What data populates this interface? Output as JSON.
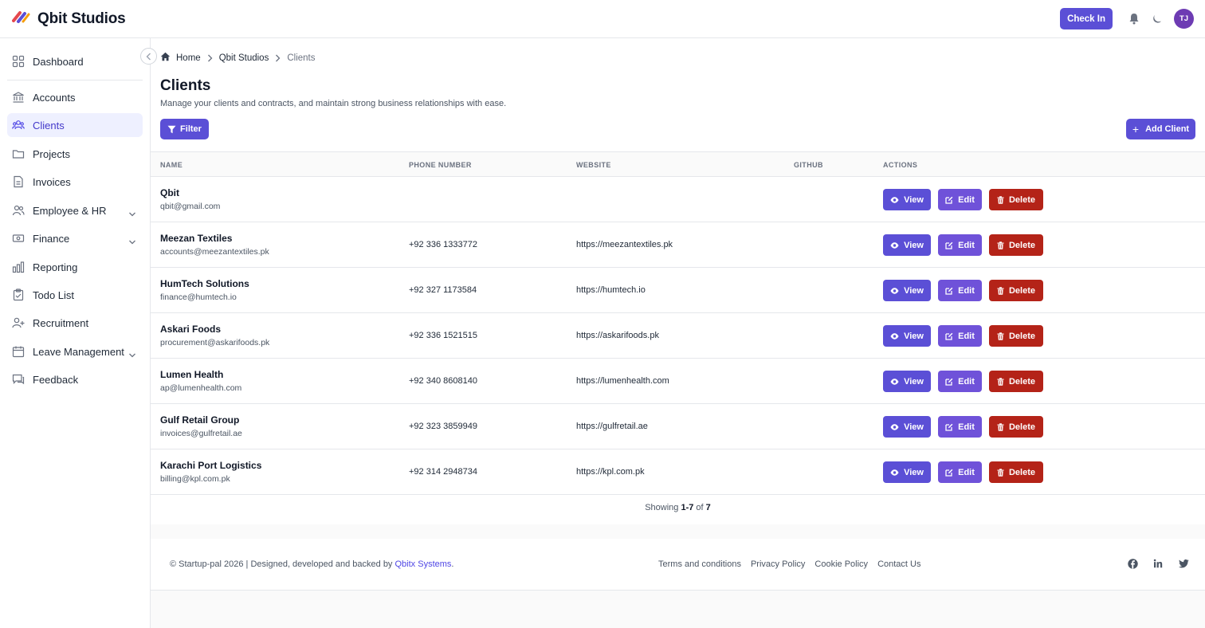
{
  "app": {
    "name": "Qbit Studios"
  },
  "topbar": {
    "checkin_label": "Check In",
    "avatar_initials": "TJ"
  },
  "sidebar": {
    "items": [
      {
        "label": "Dashboard",
        "icon": "dashboard-icon"
      },
      {
        "label": "Accounts",
        "icon": "bank-icon"
      },
      {
        "label": "Clients",
        "icon": "users-icon",
        "active": true
      },
      {
        "label": "Projects",
        "icon": "folder-icon"
      },
      {
        "label": "Invoices",
        "icon": "document-icon"
      },
      {
        "label": "Employee & HR",
        "icon": "people-icon",
        "expandable": true
      },
      {
        "label": "Finance",
        "icon": "money-icon",
        "expandable": true
      },
      {
        "label": "Reporting",
        "icon": "bar-chart-icon"
      },
      {
        "label": "Todo List",
        "icon": "clipboard-icon"
      },
      {
        "label": "Recruitment",
        "icon": "user-plus-icon"
      },
      {
        "label": "Leave Management",
        "icon": "calendar-icon",
        "expandable": true
      },
      {
        "label": "Feedback",
        "icon": "chat-icon"
      }
    ]
  },
  "breadcrumb": {
    "home": "Home",
    "parent": "Qbit Studios",
    "current": "Clients"
  },
  "page": {
    "title": "Clients",
    "subtitle": "Manage your clients and contracts, and maintain strong business relationships with ease.",
    "filter_label": "Filter",
    "add_label": "Add Client"
  },
  "table": {
    "headers": {
      "name": "NAME",
      "phone": "PHONE NUMBER",
      "website": "WEBSITE",
      "github": "GITHUB",
      "actions": "ACTIONS"
    },
    "action_labels": {
      "view": "View",
      "edit": "Edit",
      "delete": "Delete"
    },
    "rows": [
      {
        "name": "Qbit",
        "email": "qbit@gmail.com",
        "phone": "",
        "website": ""
      },
      {
        "name": "Meezan Textiles",
        "email": "accounts@meezantextiles.pk",
        "phone": "+92 336 1333772",
        "website": "https://meezantextiles.pk"
      },
      {
        "name": "HumTech Solutions",
        "email": "finance@humtech.io",
        "phone": "+92 327 1173584",
        "website": "https://humtech.io"
      },
      {
        "name": "Askari Foods",
        "email": "procurement@askarifoods.pk",
        "phone": "+92 336 1521515",
        "website": "https://askarifoods.pk"
      },
      {
        "name": "Lumen Health",
        "email": "ap@lumenhealth.com",
        "phone": "+92 340 8608140",
        "website": "https://lumenhealth.com"
      },
      {
        "name": "Gulf Retail Group",
        "email": "invoices@gulfretail.ae",
        "phone": "+92 323 3859949",
        "website": "https://gulfretail.ae"
      },
      {
        "name": "Karachi Port Logistics",
        "email": "billing@kpl.com.pk",
        "phone": "+92 314 2948734",
        "website": "https://kpl.com.pk"
      }
    ],
    "showing": {
      "prefix": "Showing",
      "range": "1-7",
      "of": "of",
      "total": "7"
    }
  },
  "footer": {
    "copyright": "© Startup-pal 2026 | Designed, developed and backed by",
    "company_link": "Qbitx Systems",
    "period": ".",
    "links": [
      "Terms and conditions",
      "Privacy Policy",
      "Cookie Policy",
      "Contact Us"
    ],
    "social": [
      "facebook-icon",
      "linkedin-icon",
      "twitter-icon"
    ]
  },
  "colors": {
    "primary": "#5b4fd6",
    "edit": "#6f52d9",
    "danger": "#b42318",
    "active_bg": "#eef0ff"
  }
}
